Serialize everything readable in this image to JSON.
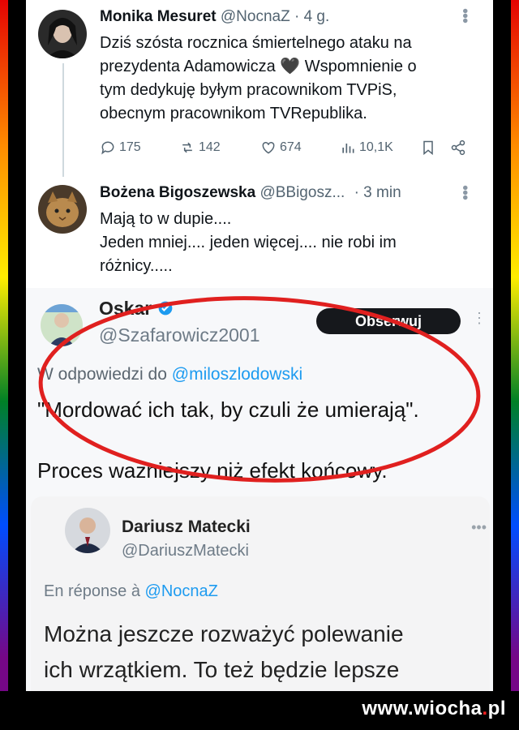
{
  "colors": {
    "accent": "#1d9bf0",
    "text": "#0f1419",
    "muted": "#536471",
    "circle": "#e0201f"
  },
  "tweet1": {
    "author": "Monika Mesuret",
    "handle": "@NocnaZ",
    "time": "· 4 g.",
    "text_line1": "Dziś szósta rocznica śmiertelnego ataku na",
    "text_line2": "prezydenta Adamowicza 🖤 Wspomnienie o",
    "text_line3": "tym dedykuję byłym pracownikom TVPiS,",
    "text_line4": "obecnym pracownikom TVRepublika.",
    "replies": "175",
    "reposts": "142",
    "likes": "674",
    "views": "10,1K"
  },
  "tweet2": {
    "author": "Bożena Bigoszewska",
    "handle": "@BBigosz...",
    "time": "· 3 min",
    "text_line1": "Mają to w dupie....",
    "text_line2": "Jeden mniej.... jeden więcej.... nie robi im",
    "text_line3": "różnicy....."
  },
  "screenshot_oskar": {
    "name": "Oskar",
    "handle": "@Szafarowicz2001",
    "follow": "Obserwuj",
    "reply_prefix": "W odpowiedzi do",
    "reply_mention": "@miloszlodowski",
    "quote": "\"Mordować ich tak, by czuli że umierają\".",
    "line2": "Proces ważniejszy niż efekt końcowy."
  },
  "screenshot_matecki": {
    "name": "Dariusz Matecki",
    "handle": "@DariuszMatecki",
    "reply_prefix": "En réponse à",
    "reply_mention": "@NocnaZ",
    "text_line1": "Można jeszcze rozważyć polewanie",
    "text_line2": "ich wrzątkiem. To też będzie lepsze"
  },
  "watermark": {
    "prefix": "www.wiocha",
    "suffix": "pl"
  }
}
